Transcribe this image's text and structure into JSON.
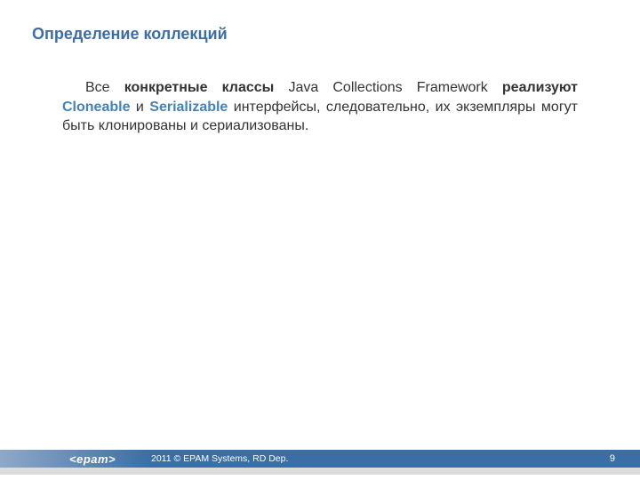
{
  "title": "Определение коллекций",
  "body": {
    "t1": "Все",
    "b1": "конкретные классы",
    "t2": "Java Collections Framework",
    "b2": "реализуют",
    "k1": "Cloneable",
    "t3": "и",
    "k2": "Serializable",
    "t4": "интерфейсы, следовательно, их экземпляры могут быть клонированы и сериализованы."
  },
  "footer": {
    "logo": "<epam>",
    "copyright": "2011 © EPAM Systems, RD Dep.",
    "page": "9"
  }
}
